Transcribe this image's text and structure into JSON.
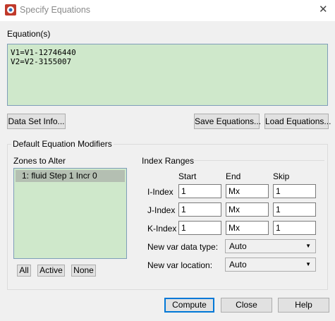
{
  "window": {
    "title": "Specify Equations",
    "close_glyph": "✕"
  },
  "equations": {
    "label": "Equation(s)",
    "text": "V1=V1-12746440\nV2=V2-3155007"
  },
  "buttons": {
    "data_set_info": "Data Set Info...",
    "save_equations": "Save Equations...",
    "load_equations": "Load Equations...",
    "all": "All",
    "active": "Active",
    "none": "None",
    "compute": "Compute",
    "close": "Close",
    "help": "Help"
  },
  "modifiers": {
    "group_label": "Default Equation Modifiers",
    "zones_label": "Zones to Alter",
    "zones": [
      "1: fluid Step 1 Incr 0"
    ],
    "index_ranges_label": "Index Ranges",
    "columns": {
      "start": "Start",
      "end": "End",
      "skip": "Skip"
    },
    "rows": [
      {
        "label": "I-Index",
        "start": "1",
        "end": "Mx",
        "skip": "1"
      },
      {
        "label": "J-Index",
        "start": "1",
        "end": "Mx",
        "skip": "1"
      },
      {
        "label": "K-Index",
        "start": "1",
        "end": "Mx",
        "skip": "1"
      }
    ],
    "new_var_data_type": {
      "label": "New var data type:",
      "value": "Auto"
    },
    "new_var_location": {
      "label": "New var location:",
      "value": "Auto"
    }
  },
  "colors": {
    "green_field": "#cfe8cb",
    "selected_zone": "#b4bfb2",
    "focus": "#0078d7"
  }
}
